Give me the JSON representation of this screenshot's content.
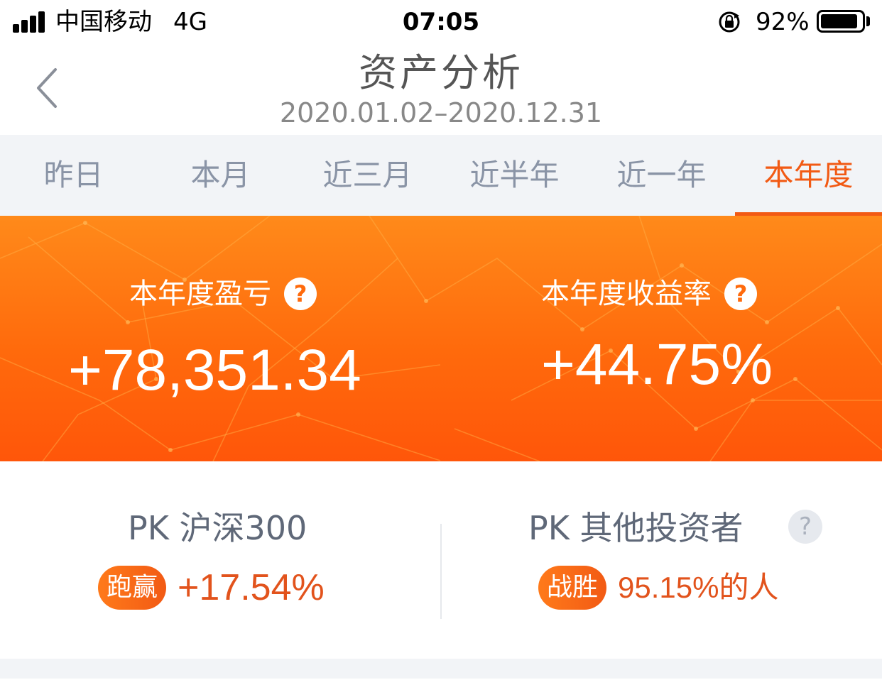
{
  "status_bar": {
    "carrier": "中国移动",
    "network": "4G",
    "time": "07:05",
    "battery_percent": "92%",
    "battery_level": 0.92
  },
  "header": {
    "title": "资产分析",
    "date_range": "2020.01.02–2020.12.31"
  },
  "tabs": [
    {
      "label": "昨日",
      "active": false
    },
    {
      "label": "本月",
      "active": false
    },
    {
      "label": "近三月",
      "active": false
    },
    {
      "label": "近半年",
      "active": false
    },
    {
      "label": "近一年",
      "active": false
    },
    {
      "label": "本年度",
      "active": true
    }
  ],
  "summary": {
    "pnl_label": "本年度盈亏",
    "pnl_value": "+78,351.34",
    "return_label": "本年度收益率",
    "return_value": "+44.75%",
    "help_glyph": "?"
  },
  "pk": {
    "index": {
      "title": "PK 沪深300",
      "badge": "跑赢",
      "value": "+17.54%"
    },
    "investors": {
      "title": "PK 其他投资者",
      "badge": "战胜",
      "value": "95.15%的人",
      "help_glyph": "?"
    }
  },
  "colors": {
    "accent": "#f25a14",
    "banner_top": "#ff8a1a",
    "banner_bottom": "#ff560a",
    "tab_inactive": "#8a94a6",
    "pk_value": "#e2531c"
  }
}
